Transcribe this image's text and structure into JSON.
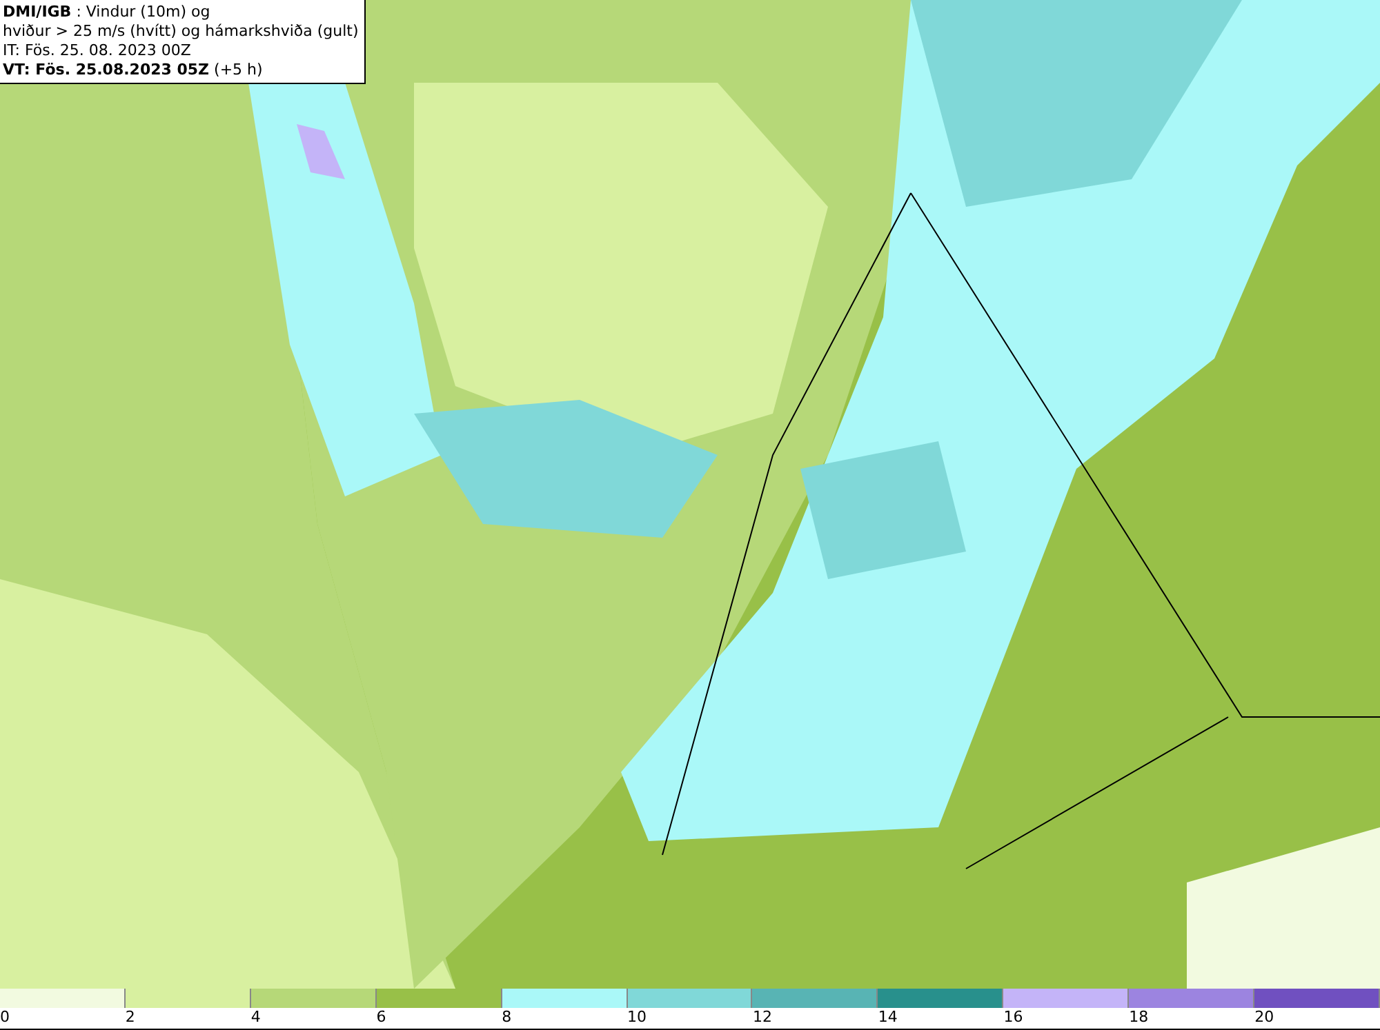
{
  "header": {
    "lines": [
      "**DMI/IGB** : Vindur (10m) og",
      "hviður > 25 m/s (hvítt) og hámarkshviða (gult)",
      "IT: Fös. 25. 08. 2023 00Z",
      "**VT: Fös. 25.08.2023 05Z** (+5 h)"
    ]
  },
  "legend": {
    "bands": [
      {
        "label": "0",
        "color": "#f2fae0"
      },
      {
        "label": "2",
        "color": "#d8f0a0"
      },
      {
        "label": "4",
        "color": "#b6d878"
      },
      {
        "label": "6",
        "color": "#98c048"
      },
      {
        "label": "8",
        "color": "#aaf8f8"
      },
      {
        "label": "10",
        "color": "#80d8d8"
      },
      {
        "label": "12",
        "color": "#58b4b4"
      },
      {
        "label": "14",
        "color": "#28908c"
      },
      {
        "label": "16",
        "color": "#c4b4f8"
      },
      {
        "label": "18",
        "color": "#9c84e0"
      },
      {
        "label": "20",
        "color": "#7050c0"
      }
    ]
  }
}
